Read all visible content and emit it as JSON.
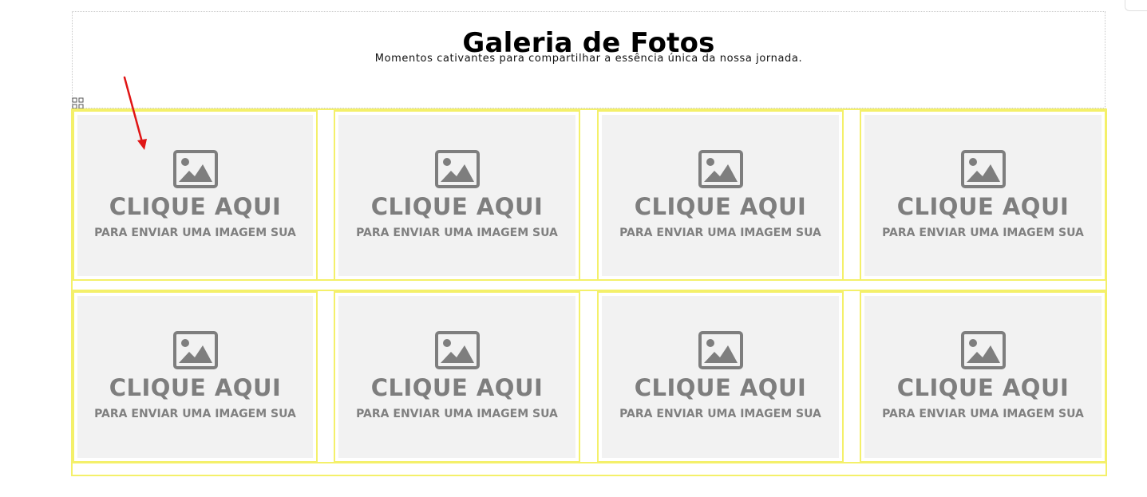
{
  "header": {
    "title": "Galeria de Fotos",
    "subtitle": "Momentos cativantes para compartilhar a essência única da nossa jornada."
  },
  "colors": {
    "selection_outline": "#f4f06a",
    "placeholder_bg": "#f2f2f2",
    "placeholder_text": "#7e7e7e",
    "arrow": "#e01515"
  },
  "gallery": {
    "items": [
      {
        "cta": "CLIQUE AQUI",
        "sub": "PARA ENVIAR UMA IMAGEM SUA",
        "icon": "image-icon"
      },
      {
        "cta": "CLIQUE AQUI",
        "sub": "PARA ENVIAR UMA IMAGEM SUA",
        "icon": "image-icon"
      },
      {
        "cta": "CLIQUE AQUI",
        "sub": "PARA ENVIAR UMA IMAGEM SUA",
        "icon": "image-icon"
      },
      {
        "cta": "CLIQUE AQUI",
        "sub": "PARA ENVIAR UMA IMAGEM SUA",
        "icon": "image-icon"
      },
      {
        "cta": "CLIQUE AQUI",
        "sub": "PARA ENVIAR UMA IMAGEM SUA",
        "icon": "image-icon"
      },
      {
        "cta": "CLIQUE AQUI",
        "sub": "PARA ENVIAR UMA IMAGEM SUA",
        "icon": "image-icon"
      },
      {
        "cta": "CLIQUE AQUI",
        "sub": "PARA ENVIAR UMA IMAGEM SUA",
        "icon": "image-icon"
      },
      {
        "cta": "CLIQUE AQUI",
        "sub": "PARA ENVIAR UMA IMAGEM SUA",
        "icon": "image-icon"
      }
    ]
  },
  "annotations": {
    "arrow_icon": "red-arrow-icon",
    "handle_icon": "drag-handle-icon"
  }
}
